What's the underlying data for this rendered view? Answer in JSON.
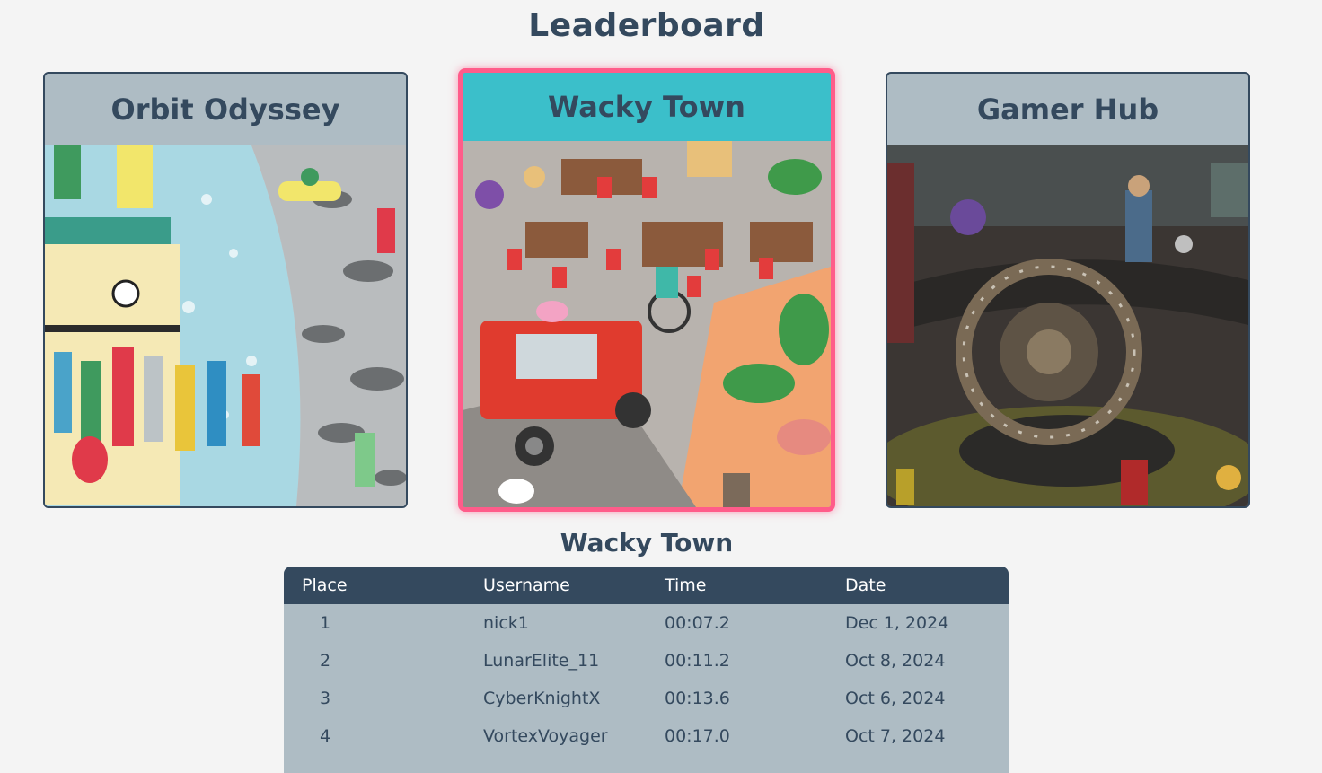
{
  "page": {
    "title": "Leaderboard"
  },
  "games": [
    {
      "name": "Orbit Odyssey",
      "image": "space-scene-illustration",
      "selected": false
    },
    {
      "name": "Wacky Town",
      "image": "town-street-illustration",
      "selected": true
    },
    {
      "name": "Gamer Hub",
      "image": "dark-gamer-hub-illustration",
      "selected": false
    }
  ],
  "colors": {
    "background": "#f4f4f4",
    "primary": "#34495e",
    "card": "#aebcc4",
    "selected_header": "#3bbfca",
    "selected_border": "#ff5c8a"
  },
  "leaderboard": {
    "title": "Wacky Town",
    "columns": [
      "Place",
      "Username",
      "Time",
      "Date"
    ],
    "rows": [
      {
        "place": "1",
        "username": "nick1",
        "time": "00:07.2",
        "date": "Dec 1, 2024"
      },
      {
        "place": "2",
        "username": "LunarElite_11",
        "time": "00:11.2",
        "date": "Oct 8, 2024"
      },
      {
        "place": "3",
        "username": "CyberKnightX",
        "time": "00:13.6",
        "date": "Oct 6, 2024"
      },
      {
        "place": "4",
        "username": "VortexVoyager",
        "time": "00:17.0",
        "date": "Oct 7, 2024"
      }
    ]
  }
}
